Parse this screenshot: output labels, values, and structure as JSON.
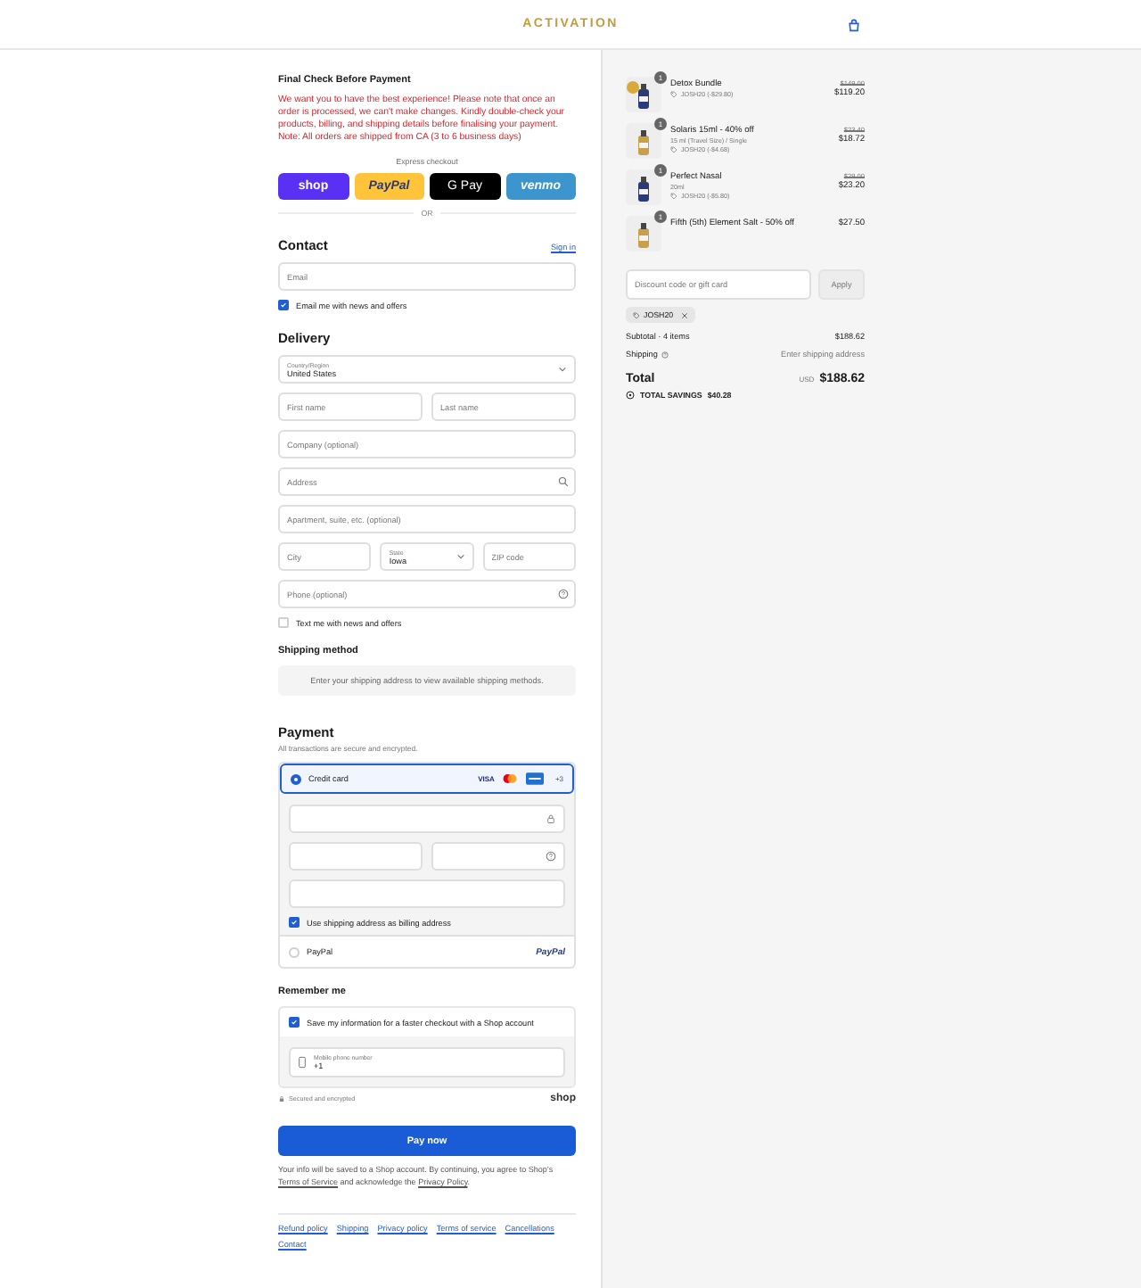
{
  "header": {
    "brand": "ACTIVATION"
  },
  "notice": {
    "title": "Final Check Before Payment",
    "text": "We want you to have the best experience! Please note that once an order is processed, we can't make changes. Kindly double-check your products, billing, and shipping details before finalising your payment. Note: All orders are shipped from CA (3 to 6 business days)"
  },
  "express": {
    "label": "Express checkout",
    "separator": "OR",
    "buttons": [
      {
        "kind": "shop",
        "label": "shop"
      },
      {
        "kind": "paypal",
        "label": "PayPal"
      },
      {
        "kind": "gpay",
        "label": "G Pay"
      },
      {
        "kind": "venmo",
        "label": "venmo"
      }
    ]
  },
  "contact": {
    "title": "Contact",
    "sign_in": "Sign in",
    "email": {
      "placeholder": "Email"
    },
    "newsletter": {
      "label": "Email me with news and offers",
      "checked": true
    }
  },
  "delivery": {
    "title": "Delivery",
    "rows": [
      [
        {
          "kind": "select",
          "label": "Country/Region",
          "value": "United States"
        }
      ],
      [
        {
          "kind": "text",
          "placeholder": "First name"
        },
        {
          "kind": "text",
          "placeholder": "Last name"
        }
      ],
      [
        {
          "kind": "text",
          "placeholder": "Company (optional)"
        }
      ],
      [
        {
          "kind": "search",
          "placeholder": "Address"
        }
      ],
      [
        {
          "kind": "text",
          "placeholder": "Apartment, suite, etc. (optional)"
        }
      ],
      [
        {
          "kind": "text",
          "placeholder": "City"
        },
        {
          "kind": "select",
          "label": "State",
          "value": "Iowa"
        },
        {
          "kind": "text",
          "placeholder": "ZIP code"
        }
      ],
      [
        {
          "kind": "help",
          "placeholder": "Phone (optional)"
        }
      ]
    ],
    "sms": {
      "label": "Text me with news and offers",
      "checked": false
    }
  },
  "shipping": {
    "title": "Shipping method",
    "message": "Enter your shipping address to view available shipping methods."
  },
  "payment": {
    "title": "Payment",
    "subtitle": "All transactions are secure and encrypted.",
    "methods": [
      {
        "kind": "card",
        "label": "Credit card",
        "selected": true,
        "visa": "VISA",
        "more": "+3",
        "billing": {
          "label": "Use shipping address as billing address",
          "checked": true
        }
      },
      {
        "kind": "paypal",
        "label": "PayPal",
        "selected": false,
        "logo": "PayPal"
      }
    ]
  },
  "remember": {
    "title": "Remember me",
    "save": {
      "label": "Save my information for a faster checkout with a Shop account",
      "checked": true
    },
    "phone": {
      "label": "Mobile phone number",
      "value": "+1"
    },
    "secure": "Secured and encrypted",
    "shop": "shop"
  },
  "pay_button": "Pay now",
  "legal": {
    "before": "Your info will be saved to a Shop account. By continuing, you agree to Shop’s ",
    "link1": "Terms of Service",
    "middle": " and acknowledge the ",
    "link2": "Privacy Policy",
    "after": "."
  },
  "footer_links": [
    "Refund policy",
    "Shipping",
    "Privacy policy",
    "Terms of service",
    "Cancellations",
    "Contact"
  ],
  "summary": {
    "items": [
      {
        "name": "Detox Bundle",
        "quantity": "1",
        "discount": "JOSH20 (-$29.80)",
        "old_price": "$149.00",
        "price": "$119.20"
      },
      {
        "name": "Solaris 15ml - 40% off",
        "quantity": "1",
        "variant": "15 ml (Travel Size) / Single",
        "discount": "JOSH20 (-$4.68)",
        "old_price": "$23.40",
        "price": "$18.72"
      },
      {
        "name": "Perfect Nasal",
        "quantity": "1",
        "variant": "20ml",
        "discount": "JOSH20 (-$5.80)",
        "old_price": "$29.00",
        "price": "$23.20"
      },
      {
        "name": "Fifth (5th) Element Salt - 50% off",
        "quantity": "1",
        "price": "$27.50"
      }
    ],
    "discount_field": {
      "placeholder": "Discount code or gift card",
      "button": "Apply"
    },
    "applied_code": "JOSH20",
    "subtotal_label": "Subtotal · 4 items",
    "subtotal": "$188.62",
    "shipping_label": "Shipping",
    "shipping_value": "Enter shipping address",
    "total_label": "Total",
    "currency": "USD",
    "total": "$188.62",
    "savings_label": "TOTAL SAVINGS",
    "savings": "$40.28"
  }
}
